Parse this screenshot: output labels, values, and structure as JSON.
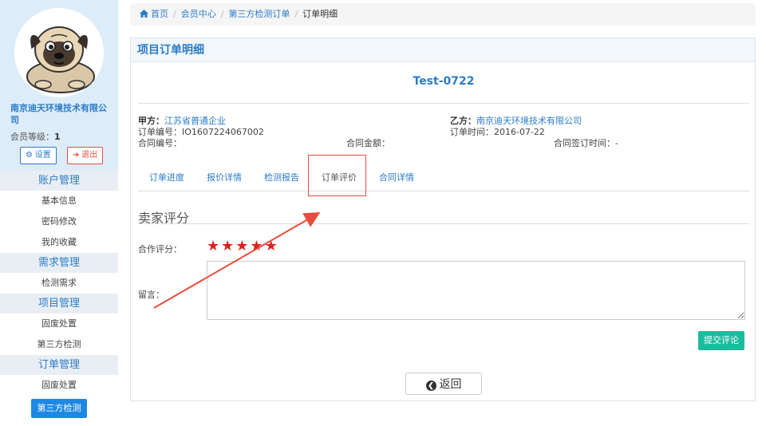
{
  "sidebar": {
    "company_name": "南京迪天环境技术有限公司",
    "member_level_label": "会员等级：",
    "member_level_value": "1",
    "settings_label": "设置",
    "logout_label": "退出",
    "groups": [
      {
        "title": "账户管理",
        "items": [
          "基本信息",
          "密码修改",
          "我的收藏"
        ]
      },
      {
        "title": "需求管理",
        "items": [
          "检测需求"
        ]
      },
      {
        "title": "项目管理",
        "items": [
          "固废处置",
          "第三方检测"
        ]
      },
      {
        "title": "订单管理",
        "items": [
          "固废处置",
          "第三方检测"
        ]
      }
    ],
    "active_item": "第三方检测"
  },
  "breadcrumb": {
    "items": [
      "首页",
      "会员中心",
      "第三方检测订单",
      "订单明细"
    ]
  },
  "panel": {
    "heading": "项目订单明细",
    "order_title": "Test-0722",
    "party_a_label": "甲方：",
    "party_a_value": "江苏省普通企业",
    "party_b_label": "乙方：",
    "party_b_value": "南京迪天环境技术有限公司",
    "order_no": "订单编号：IO1607224067002",
    "order_time": "订单时间：2016-07-22",
    "contract_no": "合同编号：",
    "contract_amount": "合同金额：",
    "contract_sign_time": "合同签订时间：-",
    "tabs": [
      "订单进度",
      "报价详情",
      "检测报告",
      "订单评价",
      "合同详情"
    ],
    "active_tab": "订单评价",
    "section_title": "卖家评分",
    "rating_label": "合作评分：",
    "rating_value": 5,
    "rating_max": 5,
    "comment_label": "留言：",
    "comment_value": "",
    "submit_label": "提交评论",
    "back_label": "返回"
  },
  "colors": {
    "accent": "#2b7cc7",
    "star": "#e02020",
    "submit": "#1abc9c",
    "active_menu": "#1e88e5",
    "annotation": "#e84c3d"
  }
}
